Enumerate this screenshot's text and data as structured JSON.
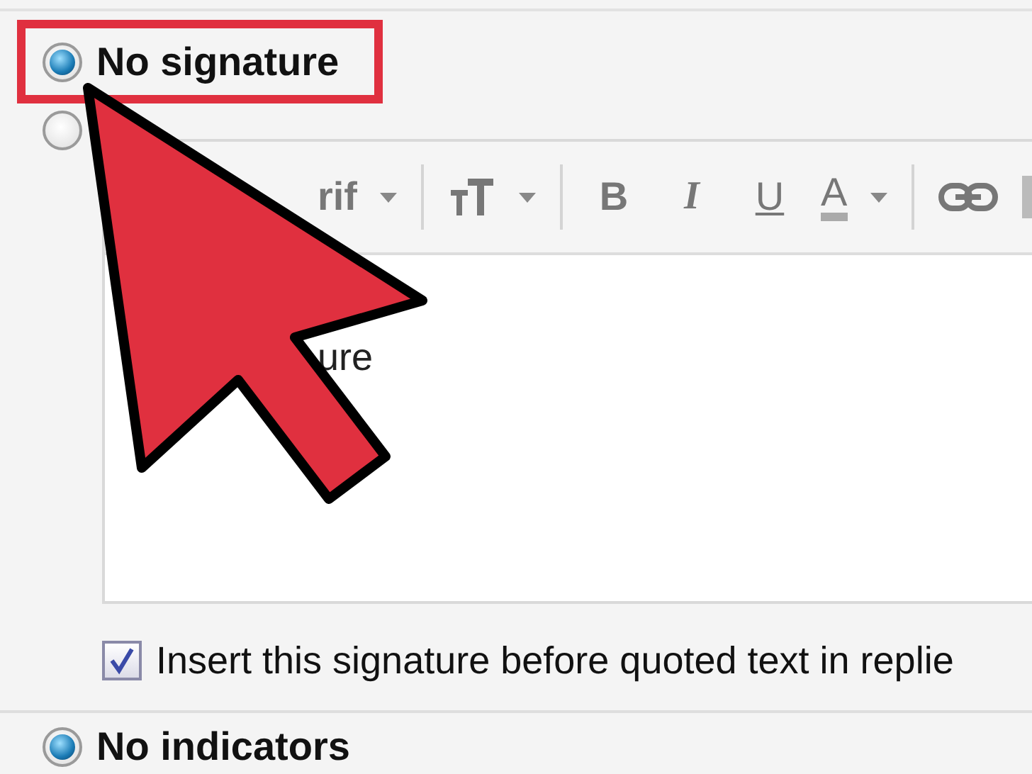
{
  "signature_options": [
    {
      "label": "No signature",
      "selected": true
    },
    {
      "selected": false
    }
  ],
  "editor": {
    "toolbar": [
      {
        "kind": "font",
        "label": "rif"
      },
      {
        "kind": "separator"
      },
      {
        "kind": "size"
      },
      {
        "kind": "separator"
      },
      {
        "kind": "bold",
        "label": "B"
      },
      {
        "kind": "italic",
        "label": "I"
      },
      {
        "kind": "underline",
        "label": "U"
      },
      {
        "kind": "color",
        "label": "A"
      },
      {
        "kind": "separator"
      },
      {
        "kind": "link"
      },
      {
        "kind": "more"
      }
    ],
    "body_text": "ure"
  },
  "insert_before_quoted": {
    "label": "Insert this signature before quoted text in replie",
    "checked": true
  },
  "indicator_options": [
    {
      "label": "No indicators",
      "selected": true
    }
  ],
  "callout": {
    "highlight": true,
    "arrow": true
  }
}
